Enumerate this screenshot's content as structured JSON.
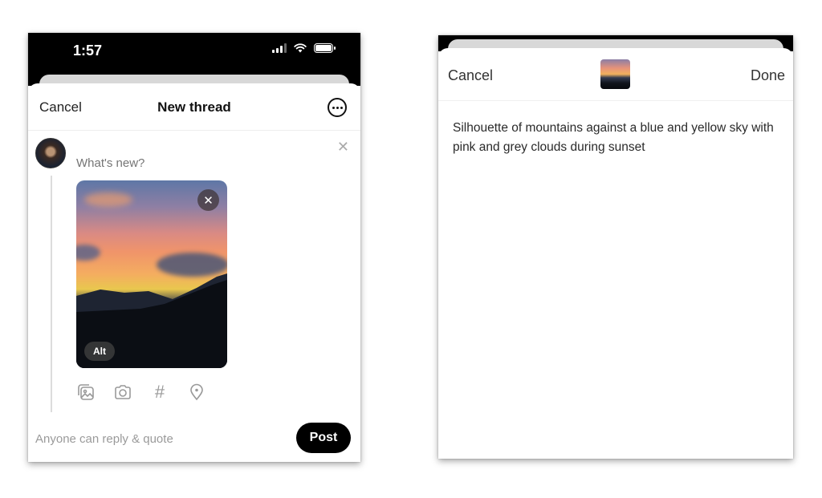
{
  "left_screen": {
    "status_bar": {
      "time": "1:57",
      "icons": [
        "signal-icon",
        "wifi-icon",
        "battery-icon"
      ]
    },
    "nav": {
      "cancel_label": "Cancel",
      "title": "New thread",
      "more_icon": "ellipsis-circle-icon"
    },
    "composer": {
      "placeholder": "What's new?",
      "value": "",
      "dismiss_icon": "close-icon"
    },
    "attachment": {
      "type": "image",
      "description": "sunset over mountains",
      "remove_icon": "close-icon",
      "alt_label": "Alt"
    },
    "toolbar": {
      "icons": [
        "gallery-icon",
        "camera-icon",
        "hashtag-icon",
        "location-pin-icon"
      ],
      "hashtag_glyph": "#"
    },
    "footer": {
      "reply_setting": "Anyone can reply & quote",
      "post_label": "Post"
    }
  },
  "right_screen": {
    "nav": {
      "cancel_label": "Cancel",
      "done_label": "Done"
    },
    "alt_text": "Silhouette of mountains against a blue and yellow sky with pink and grey clouds during sunset"
  },
  "colors": {
    "primary": "#000000",
    "placeholder": "#a0a0a0",
    "background": "#ffffff"
  }
}
